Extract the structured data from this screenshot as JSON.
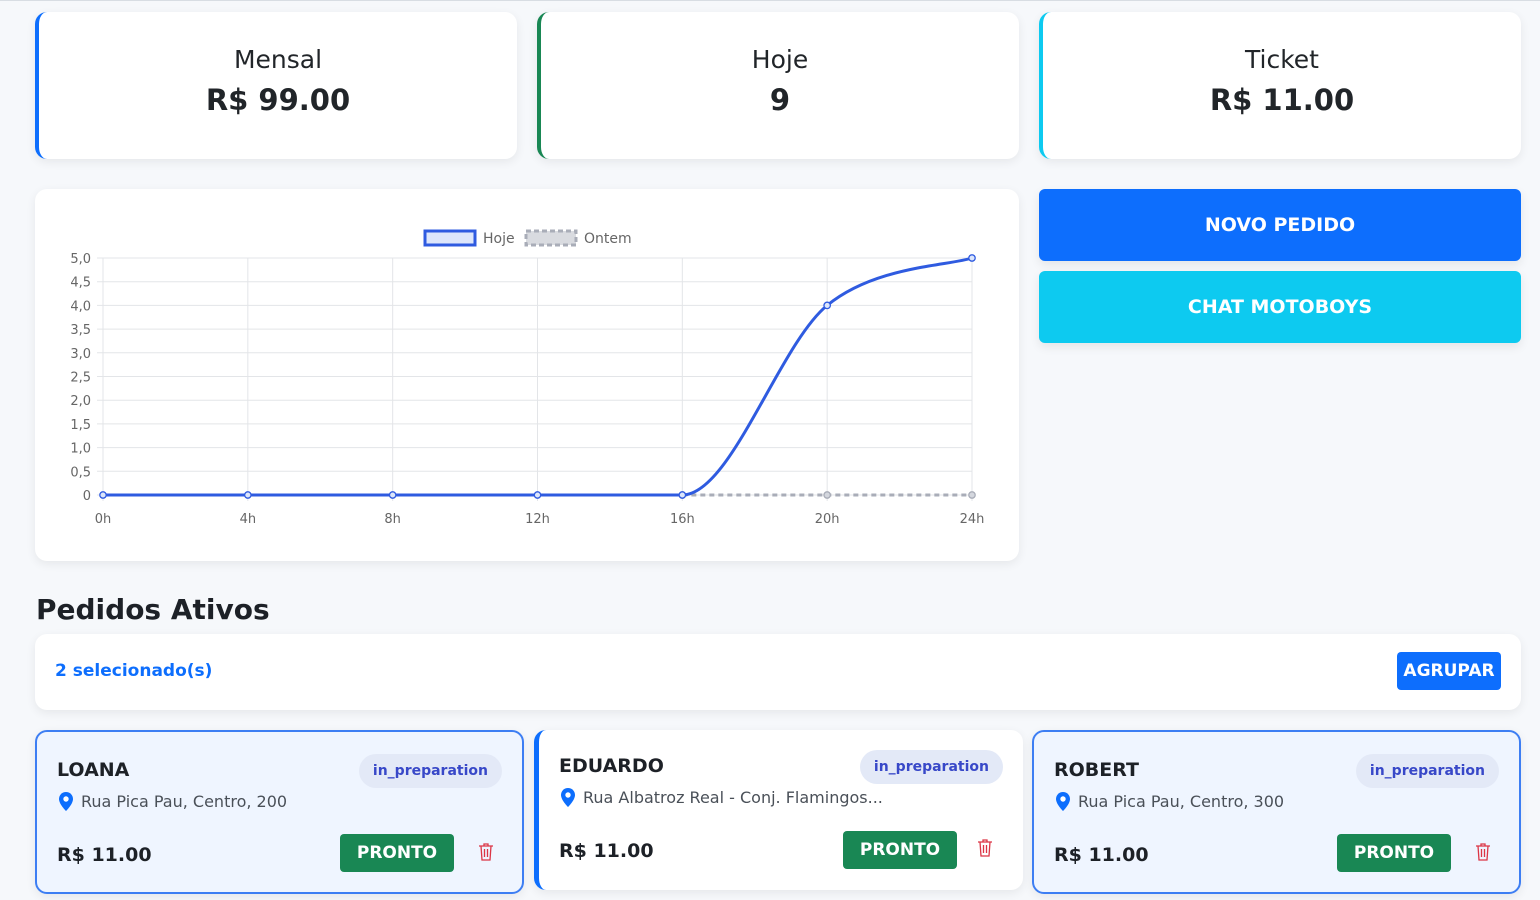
{
  "stats": [
    {
      "label": "Mensal",
      "value": "R$ 99.00",
      "accent": "#0d6efd"
    },
    {
      "label": "Hoje",
      "value": "9",
      "accent": "#198754"
    },
    {
      "label": "Ticket",
      "value": "R$ 11.00",
      "accent": "#0dcaf0"
    }
  ],
  "actions": {
    "novo_pedido": "NOVO PEDIDO",
    "chat_motoboys": "CHAT MOTOBOYS"
  },
  "chart_data": {
    "type": "line",
    "title": "",
    "xlabel": "",
    "ylabel": "",
    "legend_position": "top",
    "grid": true,
    "x": [
      "0h",
      "4h",
      "8h",
      "12h",
      "16h",
      "20h",
      "24h"
    ],
    "y_ticks": [
      "0",
      "0,5",
      "1,0",
      "1,5",
      "2,0",
      "2,5",
      "3,0",
      "3,5",
      "4,0",
      "4,5",
      "5,0"
    ],
    "ylim": [
      0,
      5
    ],
    "series": [
      {
        "name": "Hoje",
        "values": [
          0,
          0,
          0,
          0,
          0,
          4,
          5
        ],
        "color": "#2f5be0",
        "style": "solid"
      },
      {
        "name": "Ontem",
        "values": [
          null,
          null,
          null,
          null,
          0,
          0,
          0
        ],
        "color": "#a9adb8",
        "style": "dashed"
      }
    ]
  },
  "orders_section": {
    "title": "Pedidos Ativos",
    "selected_text": "2 selecionado(s)",
    "group_button": "AGRUPAR"
  },
  "orders": [
    {
      "name": "LOANA",
      "status": "in_preparation",
      "address": "Rua Pica Pau, Centro, 200",
      "price": "R$ 11.00",
      "action": "PRONTO",
      "selected": true
    },
    {
      "name": "EDUARDO",
      "status": "in_preparation",
      "address": "Rua Albatroz Real - Conj. Flamingos...",
      "price": "R$ 11.00",
      "action": "PRONTO",
      "selected": false
    },
    {
      "name": "ROBERT",
      "status": "in_preparation",
      "address": "Rua Pica Pau, Centro, 300",
      "price": "R$ 11.00",
      "action": "PRONTO",
      "selected": true
    }
  ],
  "icons": {
    "pin": "map-pin-icon",
    "trash": "trash-icon"
  },
  "colors": {
    "primary": "#0d6efd",
    "success": "#198754",
    "info": "#0dcaf0",
    "danger": "#dc3545",
    "badge_text": "#3848c8"
  }
}
